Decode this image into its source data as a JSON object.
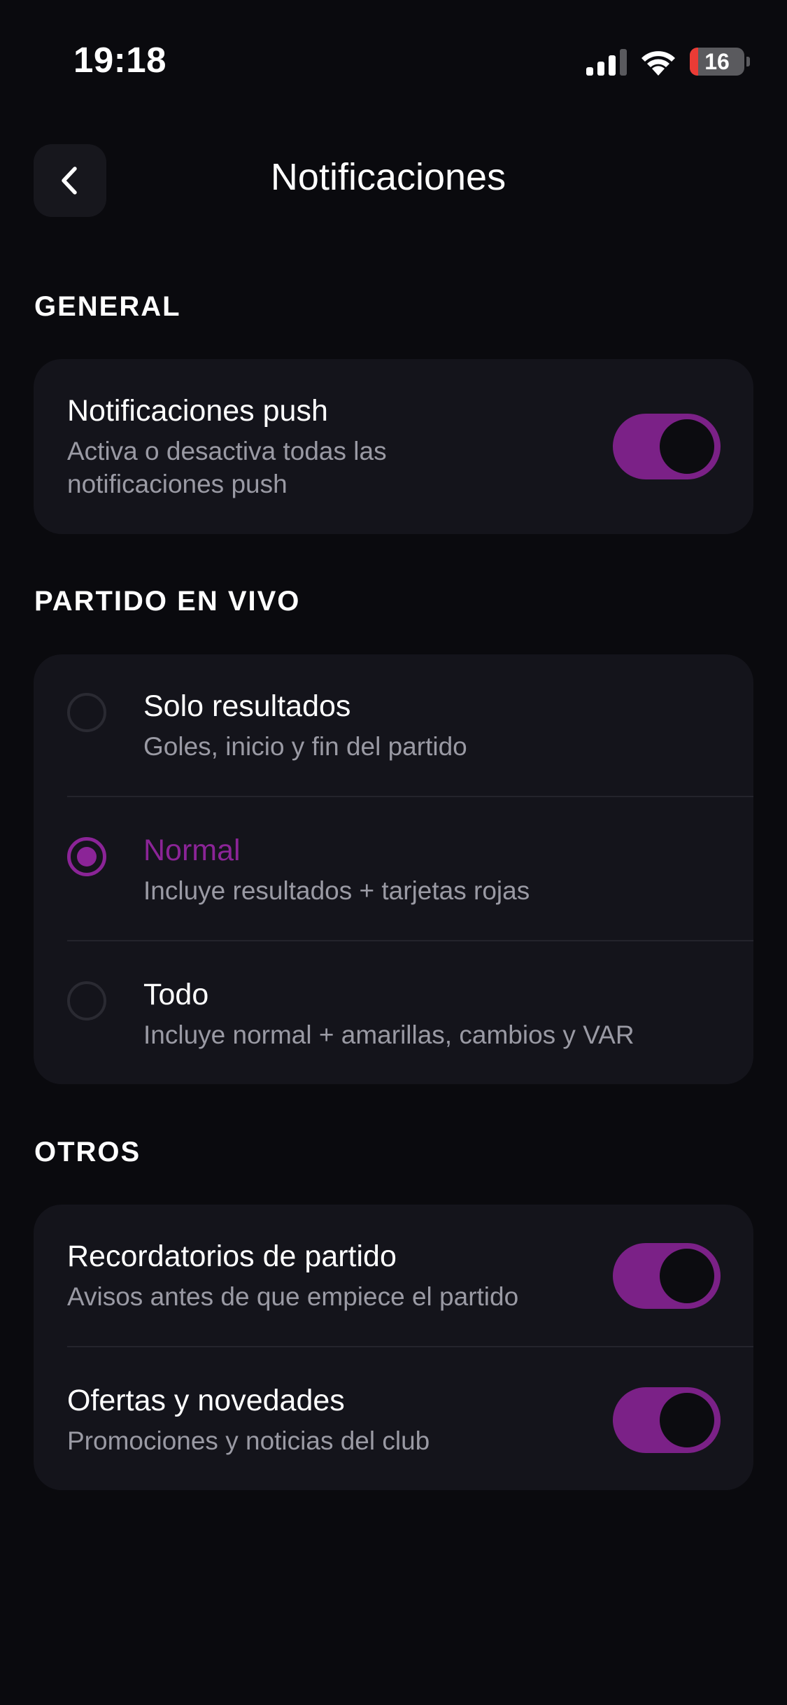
{
  "status_bar": {
    "time": "19:18",
    "battery_level": "16",
    "battery_fraction": 0.16
  },
  "header": {
    "title": "Notificaciones",
    "back_icon": "chevron-left-icon"
  },
  "sections": {
    "general": {
      "label": "GENERAL",
      "push": {
        "title": "Notificaciones push",
        "subtitle": "Activa o desactiva todas las notificaciones push",
        "enabled": true
      }
    },
    "live": {
      "label": "PARTIDO EN VIVO",
      "options": [
        {
          "title": "Solo resultados",
          "subtitle": "Goles, inicio y fin del partido",
          "selected": false
        },
        {
          "title": "Normal",
          "subtitle": "Incluye resultados + tarjetas rojas",
          "selected": true
        },
        {
          "title": "Todo",
          "subtitle": "Incluye normal + amarillas, cambios y VAR",
          "selected": false
        }
      ]
    },
    "others": {
      "label": "OTROS",
      "items": [
        {
          "title": "Recordatorios de partido",
          "subtitle": "Avisos antes de que empiece el partido",
          "enabled": true
        },
        {
          "title": "Ofertas y novedades",
          "subtitle": "Promociones y noticias del club",
          "enabled": true
        }
      ]
    }
  },
  "colors": {
    "background": "#0a0a0e",
    "card": "#14141b",
    "accent": "#8b2497",
    "text": "#ffffff",
    "muted": "#9a9aa4",
    "battery_low": "#eb3b35"
  }
}
